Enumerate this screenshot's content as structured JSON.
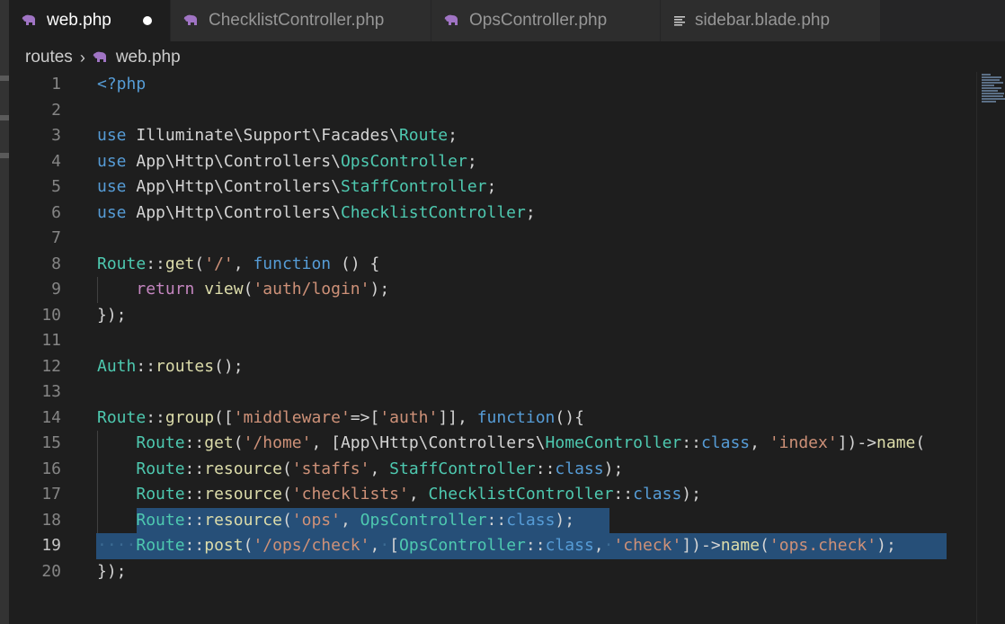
{
  "tabs": [
    {
      "label": "web.php",
      "icon": "php-elephant-icon",
      "active": true,
      "dirty": true
    },
    {
      "label": "ChecklistController.php",
      "icon": "php-elephant-icon",
      "active": false
    },
    {
      "label": "OpsController.php",
      "icon": "php-elephant-icon",
      "active": false
    },
    {
      "label": "sidebar.blade.php",
      "icon": "lines-icon",
      "active": false
    }
  ],
  "breadcrumb": {
    "folder": "routes",
    "file": "web.php"
  },
  "editor": {
    "current_line": 19,
    "lines": [
      {
        "n": "1",
        "text": "<?php"
      },
      {
        "n": "2",
        "text": ""
      },
      {
        "n": "3",
        "text": "use Illuminate\\Support\\Facades\\Route;"
      },
      {
        "n": "4",
        "text": "use App\\Http\\Controllers\\OpsController;"
      },
      {
        "n": "5",
        "text": "use App\\Http\\Controllers\\StaffController;"
      },
      {
        "n": "6",
        "text": "use App\\Http\\Controllers\\ChecklistController;"
      },
      {
        "n": "7",
        "text": ""
      },
      {
        "n": "8",
        "text": "Route::get('/', function () {"
      },
      {
        "n": "9",
        "text": "    return view('auth/login');"
      },
      {
        "n": "10",
        "text": "});"
      },
      {
        "n": "11",
        "text": ""
      },
      {
        "n": "12",
        "text": "Auth::routes();"
      },
      {
        "n": "13",
        "text": ""
      },
      {
        "n": "14",
        "text": "Route::group(['middleware'=>['auth']], function(){"
      },
      {
        "n": "15",
        "text": "    Route::get('/home', [App\\Http\\Controllers\\HomeController::class, 'index'])->name("
      },
      {
        "n": "16",
        "text": "    Route::resource('staffs', StaffController::class);"
      },
      {
        "n": "17",
        "text": "    Route::resource('checklists', ChecklistController::class);"
      },
      {
        "n": "18",
        "text": "    Route::resource('ops', OpsController::class);"
      },
      {
        "n": "19",
        "text": "    Route::post('/ops/check', [OpsController::class, 'check'])->name('ops.check');"
      },
      {
        "n": "20",
        "text": "});"
      }
    ]
  },
  "colors": {
    "keyword": "#569cd6",
    "control": "#c586c0",
    "class": "#4ec9b0",
    "function": "#dcdcaa",
    "string": "#ce9178",
    "selection": "#264f78"
  }
}
